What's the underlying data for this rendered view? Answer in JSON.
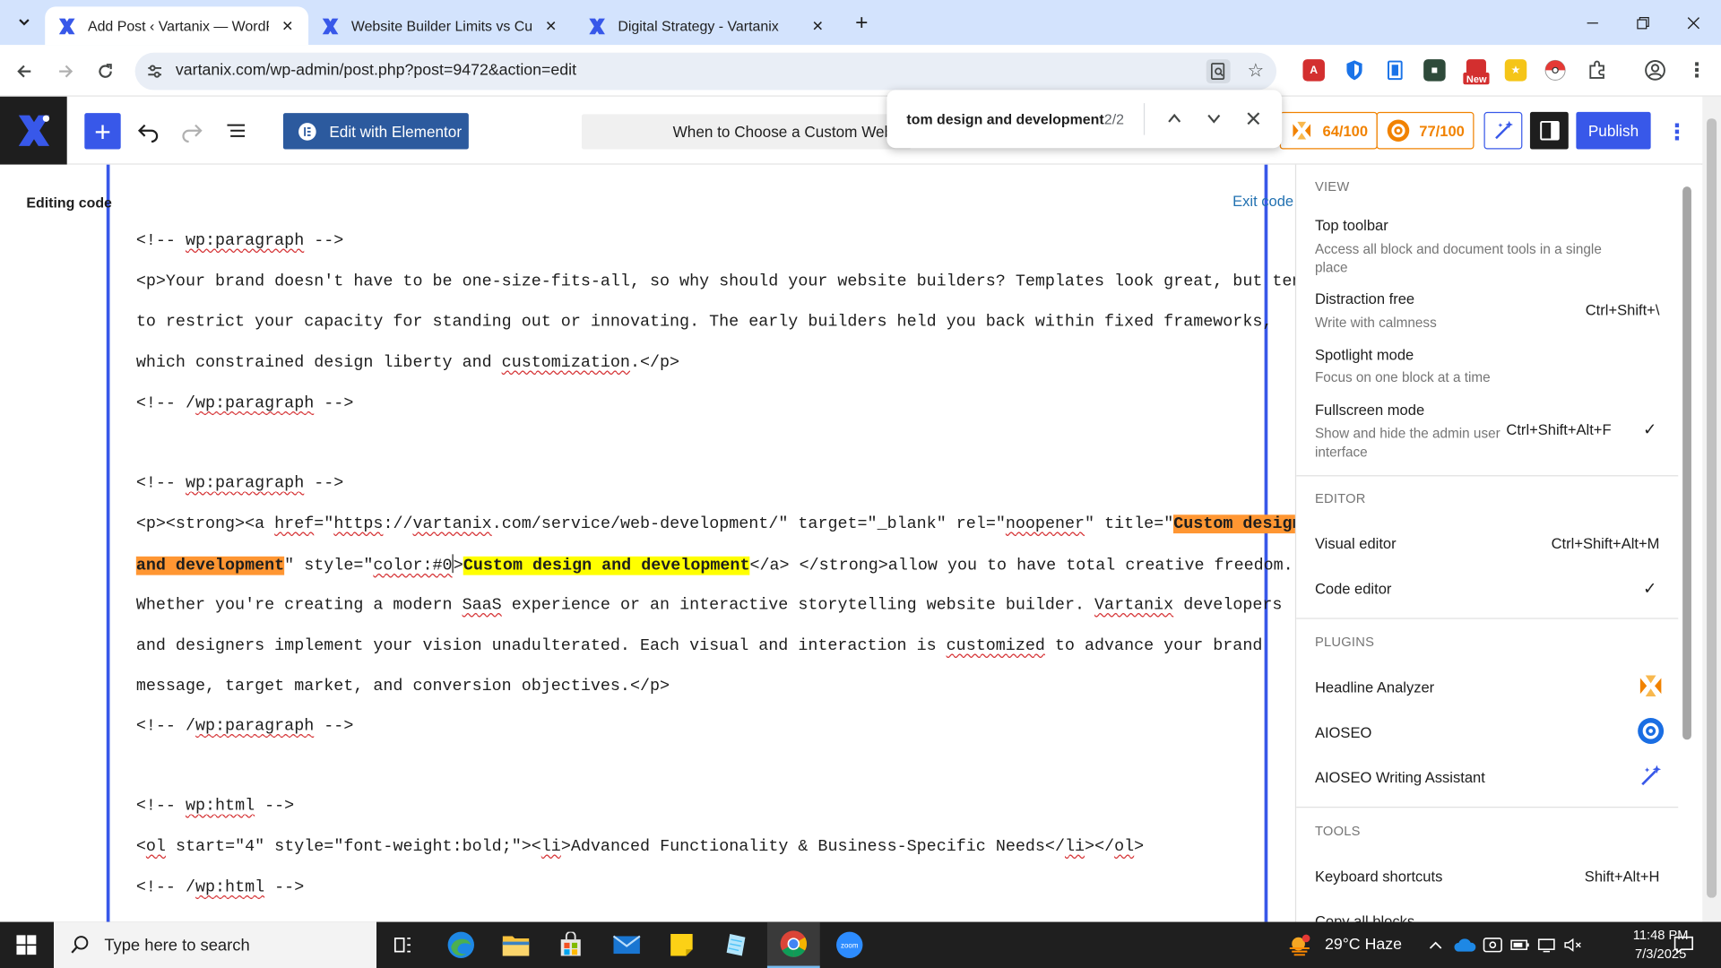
{
  "browser": {
    "tabs": [
      {
        "title": "Add Post ‹ Vartanix — WordPress",
        "active": true
      },
      {
        "title": "Website Builder Limits vs Custom",
        "active": false
      },
      {
        "title": "Digital Strategy - Vartanix",
        "active": false
      }
    ],
    "url": "vartanix.com/wp-admin/post.php?post=9472&action=edit",
    "ext_new_badge": "New"
  },
  "find": {
    "query": "tom design and development",
    "count": "2/2"
  },
  "wp": {
    "elementor_label": "Edit with Elementor",
    "doc_title": "When to Choose a Custom Website",
    "headline_score": "64/100",
    "seo_score": "77/100",
    "publish_label": "Publish",
    "editing_label": "Editing code",
    "exit_code_label": "Exit code editor"
  },
  "code": {
    "l1": "<!-- ",
    "l1b": "wp:paragraph",
    "l1c": " -->",
    "l2": "<p>Your brand doesn't have to be one-size-fits-all, so why should your website builders? Templates look great, but tend",
    "l3": "to restrict your capacity for standing out or innovating. The early builders held you back within fixed frameworks,",
    "l4a": "which constrained design liberty and ",
    "l4b": "customization",
    "l4c": ".</p>",
    "l5a": "<!-- /",
    "l5b": "wp:paragraph",
    "l5c": " -->",
    "l6a": "<!-- ",
    "l6b": "wp:paragraph",
    "l6c": " -->",
    "l7a": "<p><strong><a ",
    "l7b": "href",
    "l7c": "=\"",
    "l7d": "https",
    "l7e": "://",
    "l7f": "vartanix",
    "l7g": ".com/service/web-development/\" target=\"_blank\" rel=\"",
    "l7h": "noopener",
    "l7i": "\" title=\"",
    "l7j": "Custom design ",
    "l8a": "and development",
    "l8b": "\" style=\"",
    "l8c": "color:#0",
    "l8d": ">",
    "l8e": "Custom design and development",
    "l8f": "</a> </strong>allow you to have total creative freedom.",
    "l9a": "Whether you're creating a modern ",
    "l9b": "SaaS",
    "l9c": " experience or an interactive storytelling website builder. ",
    "l9d": "Vartanix",
    "l9e": " developers",
    "l10a": "and designers implement your vision unadulterated. Each visual and interaction is ",
    "l10b": "customized",
    "l10c": " to advance your brand",
    "l11": "message, target market, and conversion objectives.</p>",
    "l12a": "<!-- /",
    "l12b": "wp:paragraph",
    "l12c": " -->",
    "l13a": "<!-- ",
    "l13b": "wp:html",
    "l13c": " -->",
    "l14a": "<",
    "l14b": "ol",
    "l14c": " start=\"4\" style=\"font-weight:bold;\"><",
    "l14d": "li",
    "l14e": ">Advanced Functionality & Business-Specific Needs</",
    "l14f": "li",
    "l14g": "></",
    "l14h": "ol",
    "l14i": ">",
    "l15a": "<!-- /",
    "l15b": "wp:html",
    "l15c": " -->"
  },
  "menu": {
    "view_heading": "VIEW",
    "top_toolbar": "Top toolbar",
    "top_toolbar_desc": "Access all block and document tools in a single place",
    "distraction_free": "Distraction free",
    "distraction_free_desc": "Write with calmness",
    "distraction_free_sc": "Ctrl+Shift+\\",
    "spotlight": "Spotlight mode",
    "spotlight_desc": "Focus on one block at a time",
    "fullscreen": "Fullscreen mode",
    "fullscreen_desc": "Show and hide the admin user interface",
    "fullscreen_sc": "Ctrl+Shift+Alt+F",
    "check": "✓",
    "editor_heading": "EDITOR",
    "visual_editor": "Visual editor",
    "visual_editor_sc": "Ctrl+Shift+Alt+M",
    "code_editor": "Code editor",
    "plugins_heading": "PLUGINS",
    "headline_analyzer": "Headline Analyzer",
    "aioseo": "AIOSEO",
    "aioseo_writing": "AIOSEO Writing Assistant",
    "tools_heading": "TOOLS",
    "keyboard_shortcuts": "Keyboard shortcuts",
    "keyboard_shortcuts_sc": "Shift+Alt+H",
    "copy_all_blocks": "Copy all blocks"
  },
  "taskbar": {
    "search_placeholder": "Type here to search",
    "weather": "29°C  Haze",
    "time": "11:48 PM",
    "date": "7/3/2025"
  },
  "colors": {
    "wp_blue": "#3858e9",
    "aioseo_orange": "#f18200",
    "find_current": "#ff9632",
    "find_match": "#ffff00",
    "chrome_frame": "#d3e3fd"
  }
}
